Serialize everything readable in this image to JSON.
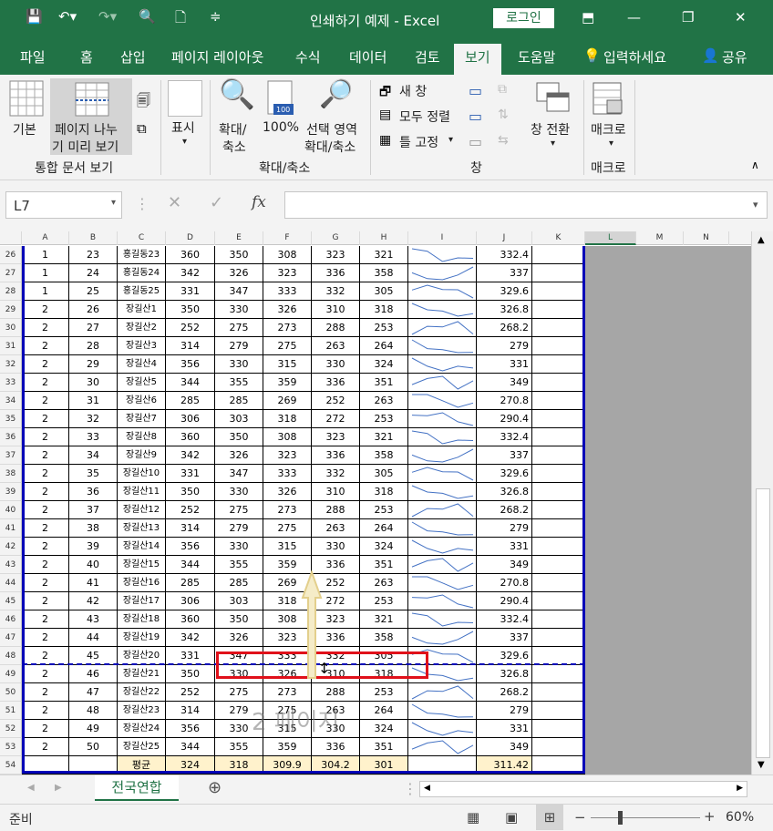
{
  "window": {
    "title": "인쇄하기 예제  -  Excel",
    "login": "로그인"
  },
  "tabs": [
    "파일",
    "홈",
    "삽입",
    "페이지 레이아웃",
    "수식",
    "데이터",
    "검토",
    "보기",
    "도움말",
    "입력하세요",
    "공유"
  ],
  "ribbon": {
    "basic": "기본",
    "page_break_1": "페이지 나누",
    "page_break_2": "기 미리 보기",
    "group_workbook_views": "통합 문서 보기",
    "show": "표시",
    "zoom_1": "확대/",
    "zoom_2": "축소",
    "zoom100": "100%",
    "zoom_sel_1": "선택 영역",
    "zoom_sel_2": "확대/축소",
    "group_zoom": "확대/축소",
    "new_window": "새 창",
    "arrange_all": "모두 정렬",
    "freeze": "틀 고정",
    "switch_1": "창 전환",
    "group_window": "창",
    "macro": "매크로",
    "group_macro": "매크로"
  },
  "formula_bar": {
    "name_box": "L7",
    "fx": "fx",
    "cancel": "✕",
    "enter": "✓"
  },
  "columns": [
    "A",
    "B",
    "C",
    "D",
    "E",
    "F",
    "G",
    "H",
    "I",
    "J",
    "K",
    "L",
    "M",
    "N"
  ],
  "rows": [
    {
      "n": "26",
      "a": "1",
      "b": "23",
      "c": "홍길동23",
      "d": "360",
      "e": "350",
      "f": "308",
      "g": "323",
      "h": "321",
      "j": "332.4"
    },
    {
      "n": "27",
      "a": "1",
      "b": "24",
      "c": "홍길동24",
      "d": "342",
      "e": "326",
      "f": "323",
      "g": "336",
      "h": "358",
      "j": "337"
    },
    {
      "n": "28",
      "a": "1",
      "b": "25",
      "c": "홍길동25",
      "d": "331",
      "e": "347",
      "f": "333",
      "g": "332",
      "h": "305",
      "j": "329.6"
    },
    {
      "n": "29",
      "a": "2",
      "b": "26",
      "c": "장길산1",
      "d": "350",
      "e": "330",
      "f": "326",
      "g": "310",
      "h": "318",
      "j": "326.8"
    },
    {
      "n": "30",
      "a": "2",
      "b": "27",
      "c": "장길산2",
      "d": "252",
      "e": "275",
      "f": "273",
      "g": "288",
      "h": "253",
      "j": "268.2"
    },
    {
      "n": "31",
      "a": "2",
      "b": "28",
      "c": "장길산3",
      "d": "314",
      "e": "279",
      "f": "275",
      "g": "263",
      "h": "264",
      "j": "279"
    },
    {
      "n": "32",
      "a": "2",
      "b": "29",
      "c": "장길산4",
      "d": "356",
      "e": "330",
      "f": "315",
      "g": "330",
      "h": "324",
      "j": "331"
    },
    {
      "n": "33",
      "a": "2",
      "b": "30",
      "c": "장길산5",
      "d": "344",
      "e": "355",
      "f": "359",
      "g": "336",
      "h": "351",
      "j": "349"
    },
    {
      "n": "34",
      "a": "2",
      "b": "31",
      "c": "장길산6",
      "d": "285",
      "e": "285",
      "f": "269",
      "g": "252",
      "h": "263",
      "j": "270.8"
    },
    {
      "n": "35",
      "a": "2",
      "b": "32",
      "c": "장길산7",
      "d": "306",
      "e": "303",
      "f": "318",
      "g": "272",
      "h": "253",
      "j": "290.4"
    },
    {
      "n": "36",
      "a": "2",
      "b": "33",
      "c": "장길산8",
      "d": "360",
      "e": "350",
      "f": "308",
      "g": "323",
      "h": "321",
      "j": "332.4"
    },
    {
      "n": "37",
      "a": "2",
      "b": "34",
      "c": "장길산9",
      "d": "342",
      "e": "326",
      "f": "323",
      "g": "336",
      "h": "358",
      "j": "337"
    },
    {
      "n": "38",
      "a": "2",
      "b": "35",
      "c": "장길산10",
      "d": "331",
      "e": "347",
      "f": "333",
      "g": "332",
      "h": "305",
      "j": "329.6"
    },
    {
      "n": "39",
      "a": "2",
      "b": "36",
      "c": "장길산11",
      "d": "350",
      "e": "330",
      "f": "326",
      "g": "310",
      "h": "318",
      "j": "326.8"
    },
    {
      "n": "40",
      "a": "2",
      "b": "37",
      "c": "장길산12",
      "d": "252",
      "e": "275",
      "f": "273",
      "g": "288",
      "h": "253",
      "j": "268.2"
    },
    {
      "n": "41",
      "a": "2",
      "b": "38",
      "c": "장길산13",
      "d": "314",
      "e": "279",
      "f": "275",
      "g": "263",
      "h": "264",
      "j": "279"
    },
    {
      "n": "42",
      "a": "2",
      "b": "39",
      "c": "장길산14",
      "d": "356",
      "e": "330",
      "f": "315",
      "g": "330",
      "h": "324",
      "j": "331"
    },
    {
      "n": "43",
      "a": "2",
      "b": "40",
      "c": "장길산15",
      "d": "344",
      "e": "355",
      "f": "359",
      "g": "336",
      "h": "351",
      "j": "349"
    },
    {
      "n": "44",
      "a": "2",
      "b": "41",
      "c": "장길산16",
      "d": "285",
      "e": "285",
      "f": "269",
      "g": "252",
      "h": "263",
      "j": "270.8"
    },
    {
      "n": "45",
      "a": "2",
      "b": "42",
      "c": "장길산17",
      "d": "306",
      "e": "303",
      "f": "318",
      "g": "272",
      "h": "253",
      "j": "290.4"
    },
    {
      "n": "46",
      "a": "2",
      "b": "43",
      "c": "장길산18",
      "d": "360",
      "e": "350",
      "f": "308",
      "g": "323",
      "h": "321",
      "j": "332.4"
    },
    {
      "n": "47",
      "a": "2",
      "b": "44",
      "c": "장길산19",
      "d": "342",
      "e": "326",
      "f": "323",
      "g": "336",
      "h": "358",
      "j": "337"
    },
    {
      "n": "48",
      "a": "2",
      "b": "45",
      "c": "장길산20",
      "d": "331",
      "e": "347",
      "f": "333",
      "g": "332",
      "h": "305",
      "j": "329.6"
    },
    {
      "n": "49",
      "a": "2",
      "b": "46",
      "c": "장길산21",
      "d": "350",
      "e": "330",
      "f": "326",
      "g": "310",
      "h": "318",
      "j": "326.8"
    },
    {
      "n": "50",
      "a": "2",
      "b": "47",
      "c": "장길산22",
      "d": "252",
      "e": "275",
      "f": "273",
      "g": "288",
      "h": "253",
      "j": "268.2"
    },
    {
      "n": "51",
      "a": "2",
      "b": "48",
      "c": "장길산23",
      "d": "314",
      "e": "279",
      "f": "275",
      "g": "263",
      "h": "264",
      "j": "279"
    },
    {
      "n": "52",
      "a": "2",
      "b": "49",
      "c": "장길산24",
      "d": "356",
      "e": "330",
      "f": "315",
      "g": "330",
      "h": "324",
      "j": "331"
    },
    {
      "n": "53",
      "a": "2",
      "b": "50",
      "c": "장길산25",
      "d": "344",
      "e": "355",
      "f": "359",
      "g": "336",
      "h": "351",
      "j": "349"
    },
    {
      "n": "54",
      "a": "",
      "b": "",
      "c": "평균",
      "d": "324",
      "e": "318",
      "f": "309.9",
      "g": "304.2",
      "h": "301",
      "j": "311.42"
    }
  ],
  "watermark": "2 페이지",
  "sheet_tab": "전국연합",
  "status": {
    "ready": "준비",
    "zoom": "60%"
  },
  "colors": {
    "excel_green": "#217346",
    "page_border": "#0000b8",
    "highlight": "#e0101a",
    "avg_fill": "#fff2cc"
  }
}
